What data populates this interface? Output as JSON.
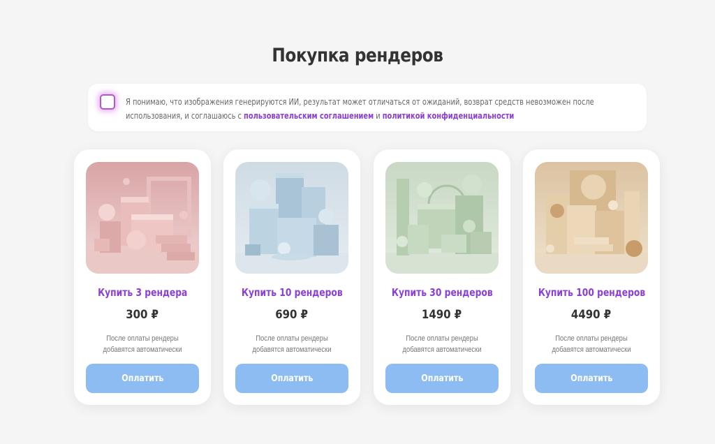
{
  "page": {
    "title": "Покупка рендеров"
  },
  "consent": {
    "text_before": "Я понимаю, что изображения генерируются ИИ, результат может отличаться от ожиданий, возврат средств невозможен после использования, и соглашаюсь с ",
    "user_agreement_link": "пользовательским соглашением",
    "text_and": " и ",
    "privacy_link": "политикой конфиденциальности",
    "checked": false
  },
  "products": [
    {
      "title": "Купить 3 рендера",
      "price": "300 ₽",
      "note": "После оплаты рендеры добавятся автоматически",
      "button": "Оплатить",
      "palette": "pink"
    },
    {
      "title": "Купить 10 рендеров",
      "price": "690 ₽",
      "note": "После оплаты рендеры добавятся автоматически",
      "button": "Оплатить",
      "palette": "blue"
    },
    {
      "title": "Купить 30 рендеров",
      "price": "1490 ₽",
      "note": "После оплаты рендеры добавятся автоматически",
      "button": "Оплатить",
      "palette": "green"
    },
    {
      "title": "Купить 100 рендеров",
      "price": "4490 ₽",
      "note": "После оплаты рендеры добавятся автоматически",
      "button": "Оплатить",
      "palette": "beige"
    }
  ],
  "colors": {
    "accent": "#8a3fd6",
    "button": "#8dbcf3",
    "background": "#f5f5f5"
  }
}
